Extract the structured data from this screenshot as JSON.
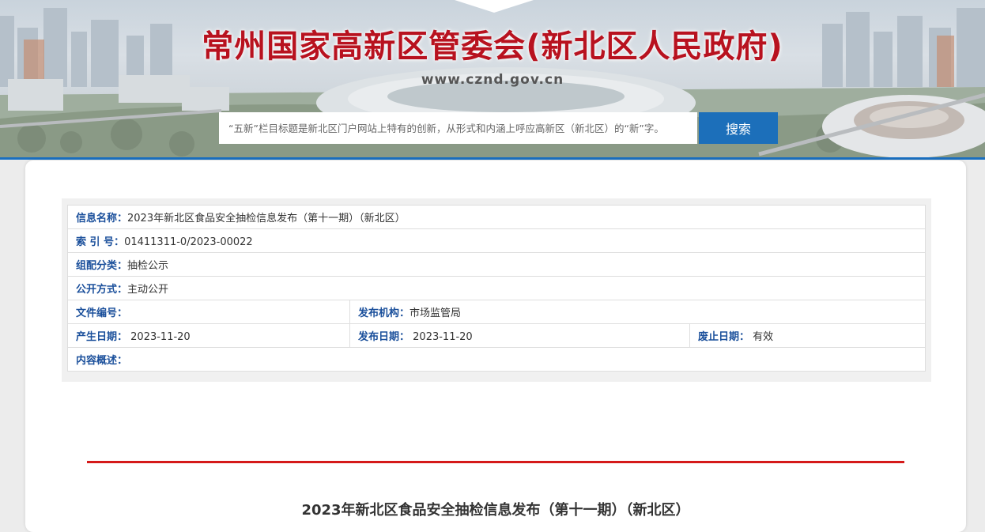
{
  "header": {
    "site_title": "常州国家高新区管委会(新北区人民政府)",
    "site_url": "www.cznd.gov.cn",
    "search_placeholder": "“五新”栏目标题是新北区门户网站上特有的创新，从形式和内涵上呼应高新区（新北区）的“新”字。",
    "search_button": "搜索"
  },
  "info": {
    "name_label": "信息名称：",
    "name_value": "2023年新北区食品安全抽检信息发布（第十一期）（新北区）",
    "index_label": "索 引 号：",
    "index_value": "01411311-0/2023-00022",
    "category_label": "组配分类：",
    "category_value": "抽检公示",
    "disclosure_label": "公开方式：",
    "disclosure_value": "主动公开",
    "docno_label": "文件编号：",
    "docno_value": "",
    "agency_label": "发布机构：",
    "agency_value": "市场监管局",
    "created_label": "产生日期：",
    "created_value": "2023-11-20",
    "published_label": "发布日期：",
    "published_value": "2023-11-20",
    "expiry_label": "废止日期：",
    "expiry_value": "有效",
    "summary_label": "内容概述：",
    "summary_value": ""
  },
  "article": {
    "title": "2023年新北区食品安全抽检信息发布（第十一期）（新北区）"
  },
  "colors": {
    "title_red": "#b8121f",
    "accent_blue": "#1c6fba",
    "label_blue": "#1a4f9b",
    "rule_red": "#d51a1a"
  }
}
